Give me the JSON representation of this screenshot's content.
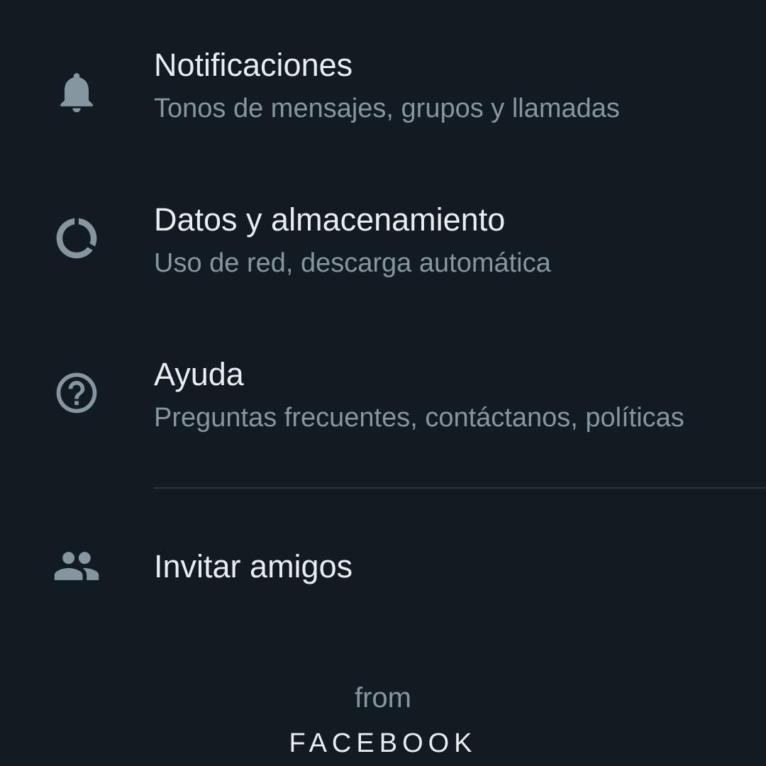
{
  "settings": {
    "items": [
      {
        "title": "Notificaciones",
        "subtitle": "Tonos de mensajes, grupos y llamadas",
        "icon": "bell-icon"
      },
      {
        "title": "Datos y almacenamiento",
        "subtitle": "Uso de red, descarga automática",
        "icon": "data-usage-icon"
      },
      {
        "title": "Ayuda",
        "subtitle": "Preguntas frecuentes, contáctanos, políticas",
        "icon": "help-icon"
      },
      {
        "title": "Invitar amigos",
        "icon": "people-icon"
      }
    ]
  },
  "footer": {
    "from_label": "from",
    "brand": "FACEBOOK"
  },
  "colors": {
    "background": "#121b22",
    "primary_text": "#e9edef",
    "secondary_text": "#8696a0",
    "icon": "#8696a0",
    "divider": "#2a353c"
  }
}
